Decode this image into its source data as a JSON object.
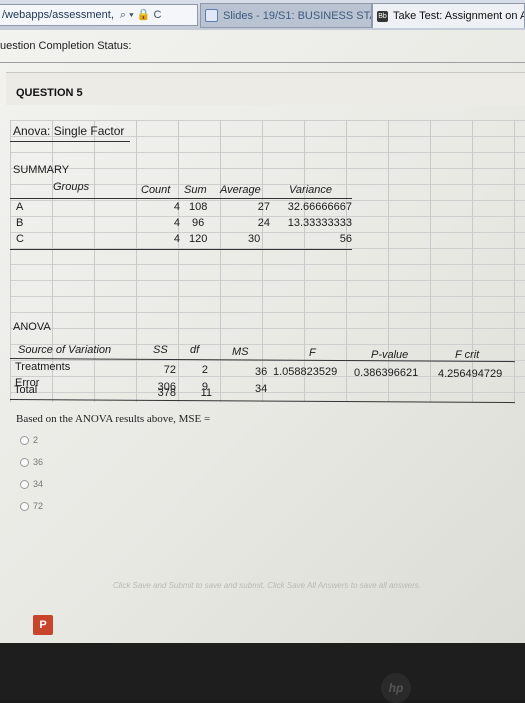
{
  "browser": {
    "address": "/webapps/assessment,",
    "address_controls": "⌕ ▾ 🔒 C",
    "tab1": "Slides - 19/S1: BUSINESS STATI...",
    "tab2": "Take Test: Assignment on A",
    "tab2_icon_text": "Bb"
  },
  "page": {
    "status_label": "uestion Completion Status:",
    "question_title": "QUESTION 5"
  },
  "sheet": {
    "title": "Anova: Single Factor",
    "summary_label": "SUMMARY",
    "summary_headers": [
      "Groups",
      "Count",
      "Sum",
      "Average",
      "Variance"
    ],
    "summary_rows": [
      {
        "group": "A",
        "count": "4",
        "sum": "108",
        "average": "27",
        "variance": "32.66666667"
      },
      {
        "group": "B",
        "count": "4",
        "sum": "96",
        "average": "24",
        "variance": "13.33333333"
      },
      {
        "group": "C",
        "count": "4",
        "sum": "120",
        "average": "30",
        "variance": "56"
      }
    ],
    "anova_label": "ANOVA",
    "anova_headers": [
      "Source of Variation",
      "SS",
      "df",
      "MS",
      "F",
      "P-value",
      "F crit"
    ],
    "anova_rows": [
      {
        "source": "Treatments",
        "ss": "72",
        "df": "2",
        "ms": "36",
        "f": "1.058823529",
        "p": "0.386396621",
        "fcrit": "4.256494729"
      },
      {
        "source": "Error",
        "ss": "306",
        "df": "9",
        "ms": "34",
        "f": "",
        "p": "",
        "fcrit": ""
      }
    ],
    "total": {
      "source": "Total",
      "ss": "378",
      "df": "11"
    }
  },
  "question": {
    "text": "Based on the ANOVA results above, MSE =",
    "options": [
      "2",
      "36",
      "34",
      "72"
    ],
    "footer": "Click Save and Submit to save and submit. Click Save All Answers to save all answers."
  },
  "taskbar": {
    "ppt_icon": "P",
    "hp_logo": "hp"
  }
}
